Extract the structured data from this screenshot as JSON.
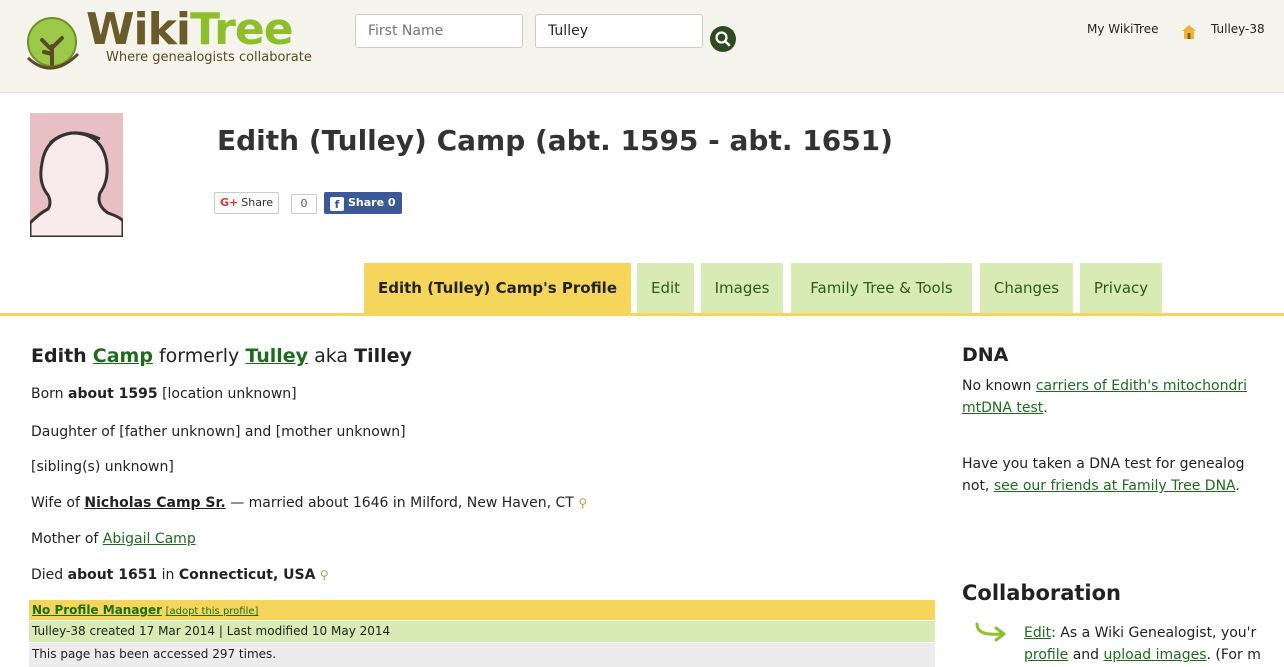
{
  "header": {
    "logo_word_1": "Wiki",
    "logo_word_2": "Tree",
    "tagline": "Where genealogists collaborate",
    "search_first_name": "First Name",
    "search_last_name": "Tulley",
    "my_wikitree": "My WikiTree",
    "user_id": "Tulley-38"
  },
  "profile": {
    "title": "Edith (Tulley) Camp (abt. 1595 - abt. 1651)",
    "share": {
      "gplus_label": "Share",
      "gplus_count": "0",
      "fb_label": "Share 0"
    }
  },
  "tabs": [
    {
      "label": "Edith (Tulley) Camp's Profile",
      "active": true
    },
    {
      "label": "Edit"
    },
    {
      "label": "Images"
    },
    {
      "label": "Family Tree & Tools"
    },
    {
      "label": "Changes"
    },
    {
      "label": "Privacy"
    }
  ],
  "bio": {
    "first_name": "Edith",
    "last_name": "Camp",
    "formerly_label": "formerly",
    "maiden_name": "Tulley",
    "aka_label": "aka",
    "aka_name": "Tilley",
    "born_prefix": "Born",
    "born_date": "about 1595",
    "born_place": "[location unknown]",
    "parents": "Daughter of [father unknown] and [mother unknown]",
    "siblings": "[sibling(s) unknown]",
    "wife_prefix": "Wife of",
    "spouse": "Nicholas Camp Sr.",
    "marriage": "— married about 1646 in Milford, New Haven, CT",
    "mother_prefix": "Mother of",
    "child": "Abigail Camp",
    "died_prefix": "Died",
    "died_date": "about 1651",
    "died_in": "in",
    "died_place": "Connecticut, USA"
  },
  "manager": {
    "no_manager": "No Profile Manager",
    "adopt": "[adopt this profile]",
    "created": "Tulley-38 created 17 Mar 2014 | Last modified 10 May 2014",
    "accessed": "This page has been accessed 297 times."
  },
  "dna": {
    "heading": "DNA",
    "line1_prefix": "No known",
    "line1_link": "carriers of Edith's mitochondri",
    "line2_link": "mtDNA test",
    "line2_suffix": ".",
    "line3": "Have you taken a DNA test for genealog",
    "line4_prefix": "not,",
    "line4_link": "see our friends at Family Tree DNA",
    "line4_suffix": "."
  },
  "collaboration": {
    "heading": "Collaboration",
    "edit_link": "Edit",
    "text1": ": As a Wiki Genealogist, you'r",
    "profile_link": "profile",
    "and_text": "and",
    "images_link": "upload images",
    "text2": ". (For m"
  },
  "colors": {
    "tab_active": "#f6d65a",
    "tab": "#d8ebb5",
    "link": "#1e6b1e",
    "header_bg": "#f4f3ec"
  }
}
